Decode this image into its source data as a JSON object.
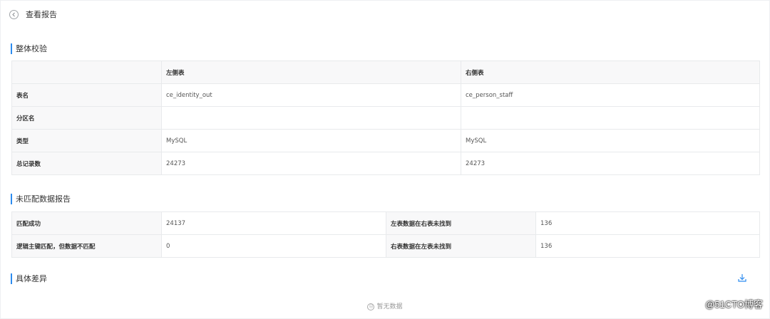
{
  "header": {
    "title": "查看报告"
  },
  "overall": {
    "title": "整体校验",
    "columns": [
      "",
      "左侧表",
      "右侧表"
    ],
    "rows": [
      {
        "label": "表名",
        "left": "ce_identity_out",
        "right": "ce_person_staff"
      },
      {
        "label": "分区名",
        "left": "",
        "right": ""
      },
      {
        "label": "类型",
        "left": "MySQL",
        "right": "MySQL"
      },
      {
        "label": "总记录数",
        "left": "24273",
        "right": "24273"
      }
    ]
  },
  "unmatched": {
    "title": "未匹配数据报告",
    "rows": [
      {
        "label1": "匹配成功",
        "value1": "24137",
        "label2": "左表数据在右表未找到",
        "value2": "136"
      },
      {
        "label1": "逻辑主键匹配，但数据不匹配",
        "value1": "0",
        "label2": "右表数据在左表未找到",
        "value2": "136"
      }
    ]
  },
  "diff": {
    "title": "具体差异",
    "empty_text": "暂无数据"
  },
  "watermark": "@51CTO博客",
  "colors": {
    "accent": "#2d8cf0",
    "border": "#e8eaec",
    "header_bg": "#f8f8f9"
  }
}
